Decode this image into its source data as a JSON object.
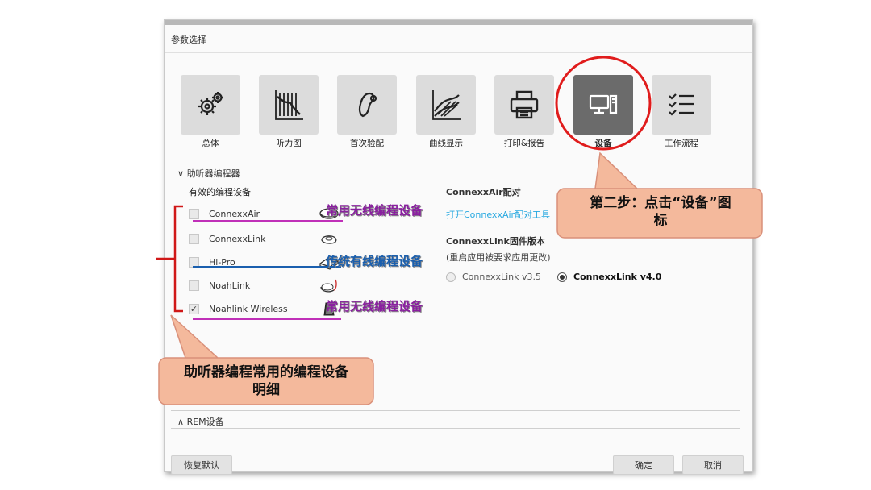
{
  "dialog": {
    "title": "参数选择"
  },
  "categories": [
    {
      "label": "总体",
      "icon": "gear-icon"
    },
    {
      "label": "听力图",
      "icon": "audiogram-icon"
    },
    {
      "label": "首次验配",
      "icon": "hearing-aid-icon"
    },
    {
      "label": "曲线显示",
      "icon": "curve-icon"
    },
    {
      "label": "打印&报告",
      "icon": "printer-icon"
    },
    {
      "label": "设备",
      "icon": "computer-icon"
    },
    {
      "label": "工作流程",
      "icon": "checklist-icon"
    }
  ],
  "programmer_section": {
    "header": "助听器编程器",
    "available_label": "有效的编程设备",
    "devices": [
      {
        "name": "ConnexxAir",
        "checked": false,
        "icon": "connexxair-device-icon"
      },
      {
        "name": "ConnexxLink",
        "checked": false,
        "icon": "connexxlink-device-icon"
      },
      {
        "name": "Hi-Pro",
        "checked": false,
        "icon": "hipro-device-icon"
      },
      {
        "name": "NoahLink",
        "checked": false,
        "icon": "noahlink-device-icon"
      },
      {
        "name": "Noahlink Wireless",
        "checked": true,
        "icon": "noahlink-wireless-device-icon"
      }
    ],
    "air_pairing": {
      "label": "ConnexxAir配对",
      "link": "打开ConnexxAir配对工具"
    },
    "firmware": {
      "label": "ConnexxLink固件版本",
      "note": "(重启应用被要求应用更改)",
      "options": [
        {
          "label": "ConnexxLink v3.5",
          "selected": false
        },
        {
          "label": "ConnexxLink v4.0",
          "selected": true
        }
      ]
    }
  },
  "rem_section": {
    "header": "REM设备"
  },
  "buttons": {
    "restore": "恢复默认",
    "ok": "确定",
    "cancel": "取消"
  },
  "annotations": {
    "wireless_1": "常用无线编程设备",
    "wired": "传统有线编程设备",
    "wireless_2": "常用无线编程设备",
    "step2_line1": "第二步：点击“设备”图",
    "step2_line2": "标",
    "detail_line1": "助听器编程常用的编程设备",
    "detail_line2": "明细"
  },
  "colors": {
    "wireless_annotation": "#8a1fa0",
    "wired_annotation": "#1a5fae",
    "callout_fill": "#f4b99c",
    "callout_border": "#d9907a",
    "highlight_circle": "#e01c1c"
  }
}
